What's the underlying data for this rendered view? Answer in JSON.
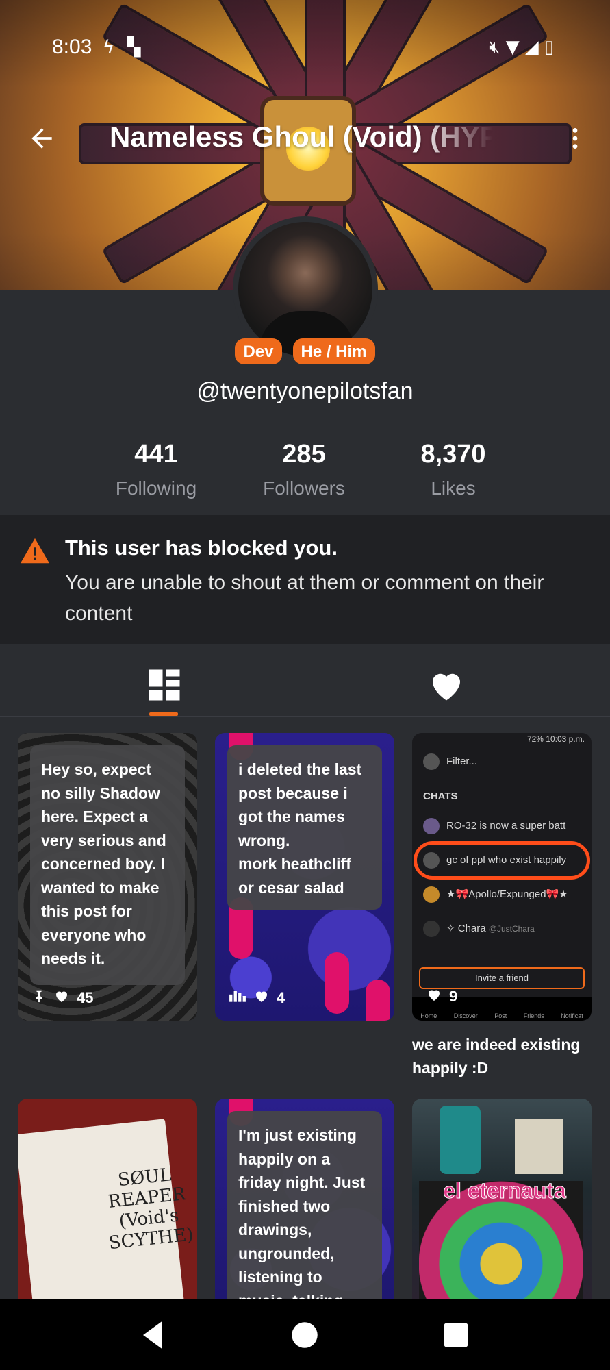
{
  "status_bar": {
    "time": "8:03",
    "left_icons": [
      "flash-icon",
      "notification-icon"
    ],
    "right_icons": [
      "mute-icon",
      "wifi-icon",
      "signal-icon",
      "battery-charging-icon"
    ]
  },
  "header": {
    "title": "Nameless Ghoul (Void) (HYPE)"
  },
  "profile": {
    "badges": [
      "Dev",
      "He / Him"
    ],
    "handle": "@twentyonepilotsfan",
    "stats": [
      {
        "value": "441",
        "label": "Following"
      },
      {
        "value": "285",
        "label": "Followers"
      },
      {
        "value": "8,370",
        "label": "Likes"
      }
    ]
  },
  "notice": {
    "title": "This user has blocked you.",
    "body": "You are unable to shout at them or comment on their content"
  },
  "tabs": [
    {
      "icon": "grid-posts-icon",
      "active": true
    },
    {
      "icon": "heart-icon",
      "active": false
    }
  ],
  "posts": [
    {
      "text": "Hey so, expect no silly Shadow here. Expect a very serious and concerned boy. I wanted to make this post for everyone who needs it.",
      "likes": "45",
      "pinned": true
    },
    {
      "text": "i deleted the last post because i got the names wrong.\nmork heathcliff or cesar salad",
      "likes": "4",
      "pinned": false
    },
    {
      "likes": "9",
      "caption": "we are indeed existing happily :D",
      "screenshot": {
        "status": "72% 10:03 p.m.",
        "filter": "Filter...",
        "chats_label": "CHATS",
        "chats": [
          "RO-32 is now a super batt",
          "gc of ppl who exist happily",
          "★🎀Apollo/Expunged🎀★",
          "✧ Chara"
        ],
        "chara_handle": "@JustChara",
        "invite": "Invite a friend",
        "nav": [
          "Home",
          "Discover",
          "Post",
          "Friends",
          "Notificat"
        ]
      }
    },
    {
      "image_text": "SØUL REAPER (Void's SCYTHE)"
    },
    {
      "text": "I'm just existing happily on a friday night. Just finished two drawings, ungrounded, listening to music, talking"
    },
    {
      "image_text": "el eternauta"
    }
  ],
  "colors": {
    "accent": "#ef6a1b",
    "background": "#2b2d31",
    "notice_bg": "#202124"
  }
}
